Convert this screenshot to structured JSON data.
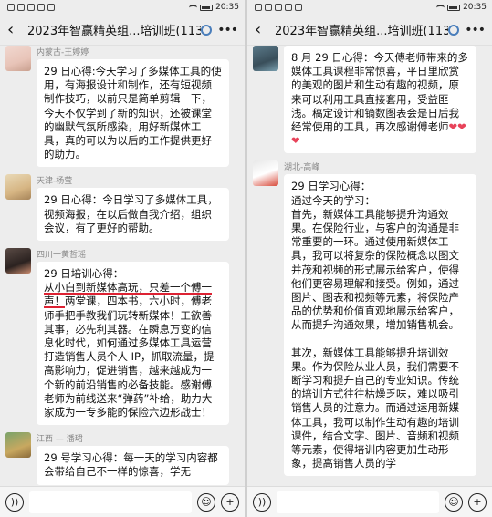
{
  "status": {
    "time": "20:35"
  },
  "left": {
    "title": "2023年智赢精英组...培训班(113)",
    "messages": [
      {
        "sender": "内蒙古-王婷婷",
        "avatar": "avatar-photo",
        "paragraphs": [
          "29 日心得:今天学习了多媒体工具的使用，有海报设计和制作，还有短视频制作技巧，以前只是简单剪辑一下，今天不仅学到了新的知识，还被课堂的幽默气氛所感染，用好新媒体工具，真的可以为以后的工作提供更好的助力。"
        ]
      },
      {
        "sender": "天津-杨莹",
        "avatar": "avatar-photo",
        "paragraphs": [
          "29 日心得：今日学习了多媒体工具，视频海报，在以后做自我介绍，组织会议，有了更好的帮助。"
        ]
      },
      {
        "sender": "四川一黄哲瑶",
        "avatar": "avatar-photo",
        "intro": "29 日培训心得：",
        "highlight": "从小白到新媒体高玩，只差一个傅一声！",
        "rest": "两堂课，四本书，六小时，傅老师手把手教我们玩转新媒体！工欲善其事，必先利其器。在瞬息万变的信息化时代，如何通过多媒体工具运营打造销售人员个人 IP，抓取流量，提高影响力，促进销售，越来越成为一个新的前沿销售的必备技能。感谢傅老师为前线送来“弹药”补给，助力大家成为一专多能的保险六边形战士！"
      },
      {
        "sender": "江西 — 潘珺",
        "avatar": "avatar-photo",
        "paragraphs": [
          "29 号学习心得：每一天的学习内容都会带给自己不一样的惊喜，学无"
        ]
      }
    ]
  },
  "right": {
    "title": "2023年智赢精英组...培训班(113)",
    "messages": [
      {
        "sender": "",
        "avatar": "avatar-photo",
        "text": "8 月 29 日心得：今天傅老师带来的多媒体工具课程非常惊喜，平日里欣赏的美观的图片和生动有趣的视频，原来可以利用工具直接套用，受益匪浅。稿定设计和镝数图表会是日后我经常使用的工具，再次感谢傅老师",
        "hearts": "❤❤❤"
      },
      {
        "sender": "湖北-高峰",
        "avatar": "avatar-photo",
        "paragraphs": [
          "29 日学习心得：\n通过今天的学习：\n首先，新媒体工具能够提升沟通效果。在保险行业，与客户的沟通是非常重要的一环。通过使用新媒体工具，我可以将复杂的保险概念以图文并茂和视频的形式展示给客户，使得他们更容易理解和接受。例如，通过图片、图表和视频等元素，将保险产品的优势和价值直观地展示给客户，从而提升沟通效果，增加销售机会。",
          "其次，新媒体工具能够提升培训效果。作为保险从业人员，我们需要不断学习和提升自己的专业知识。传统的培训方式往往枯燥乏味，难以吸引销售人员的注意力。而通过运用新媒体工具，我可以制作生动有趣的培训课件，结合文字、图片、音频和视频等元素，使得培训内容更加生动形象，提高销售人员的学"
        ]
      }
    ]
  },
  "icons": {
    "back": "chevron-left-icon",
    "search": "search-person-icon",
    "more": "more-dots-icon",
    "voice": "voice-icon",
    "emoji": "emoji-icon",
    "plus": "plus-icon"
  }
}
